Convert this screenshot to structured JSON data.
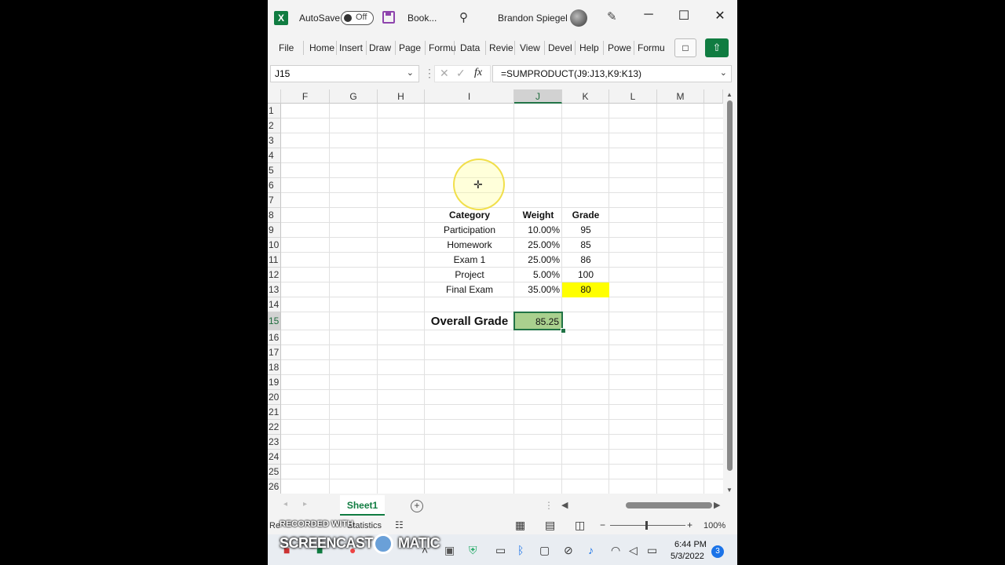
{
  "titlebar": {
    "app_icon": "X",
    "autosave_label": "AutoSave",
    "toggle_state": "Off",
    "book_name": "Book...",
    "user_name": "Brandon Spiegel",
    "minimize": "─",
    "maximize": "☐",
    "close": "✕"
  },
  "ribbon": {
    "tabs": [
      "File",
      "Home",
      "Insert",
      "Draw",
      "Page",
      "Formu",
      "Data",
      "Revie",
      "View",
      "Devel",
      "Help",
      "Powe",
      "Formu"
    ]
  },
  "formula_bar": {
    "name_box": "J15",
    "fx": "fx",
    "formula": "=SUMPRODUCT(J9:J13,K9:K13)"
  },
  "columns": [
    "F",
    "G",
    "H",
    "I",
    "J",
    "K",
    "L",
    "M"
  ],
  "selected_column": "J",
  "rows": [
    "1",
    "2",
    "3",
    "4",
    "5",
    "6",
    "7",
    "8",
    "9",
    "10",
    "11",
    "12",
    "13",
    "14",
    "15",
    "16",
    "17",
    "18",
    "19",
    "20",
    "21",
    "22",
    "23",
    "24",
    "25",
    "26"
  ],
  "selected_row": "15",
  "table": {
    "headers": [
      "Category",
      "Weight",
      "Grade"
    ],
    "rows": [
      [
        "Participation",
        "10.00%",
        "95"
      ],
      [
        "Homework",
        "25.00%",
        "85"
      ],
      [
        "Exam 1",
        "25.00%",
        "86"
      ],
      [
        "Project",
        "5.00%",
        "100"
      ],
      [
        "Final Exam",
        "35.00%",
        "80"
      ]
    ],
    "overall_label": "Overall Grade",
    "overall_value": "85.25"
  },
  "highlight_colors": {
    "k13": "#ffff00",
    "j15": "#a9d08e",
    "accent": "#107c41"
  },
  "sheets": {
    "active": "Sheet1",
    "add": "+"
  },
  "statusbar": {
    "left": "Re",
    "statistics": "Statistics",
    "zoom": "100%",
    "zoom_minus": "−",
    "zoom_plus": "+"
  },
  "watermark": {
    "line1": "RECORDED WITH",
    "line2": "SCREENCAST",
    "line3": "MATIC"
  },
  "taskbar": {
    "time": "6:44 PM",
    "date": "5/3/2022",
    "notifications": "3"
  }
}
